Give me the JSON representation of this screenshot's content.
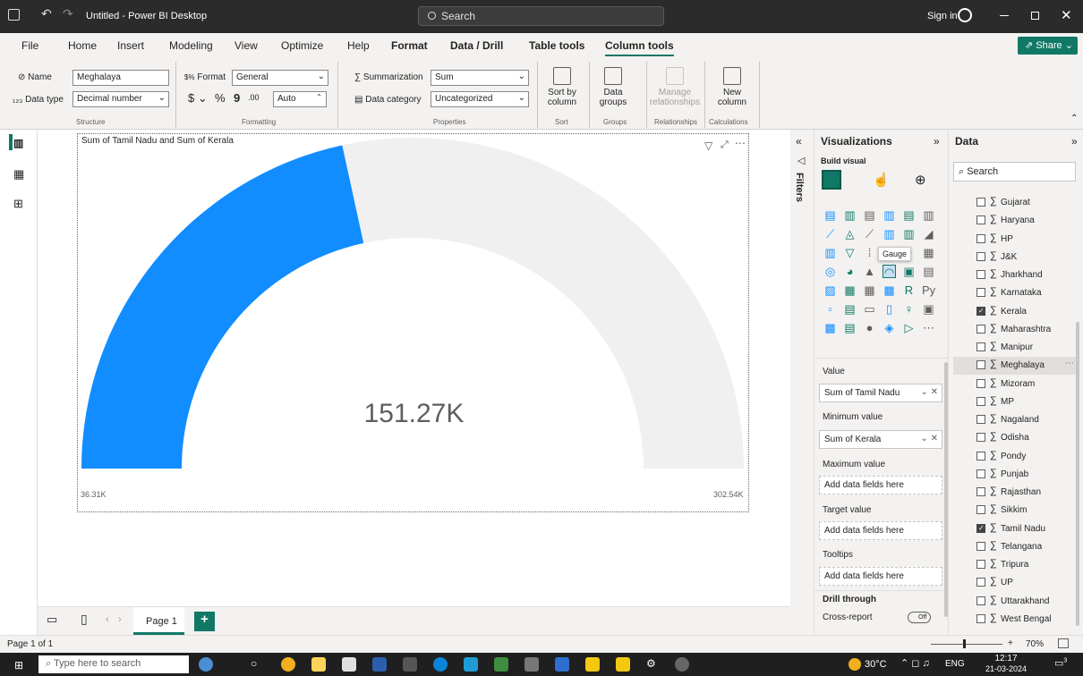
{
  "titlebar": {
    "doc_title": "Untitled - Power BI Desktop",
    "search_placeholder": "Search",
    "sign_in": "Sign in"
  },
  "tabs": [
    "File",
    "Home",
    "Insert",
    "Modeling",
    "View",
    "Optimize",
    "Help",
    "Format",
    "Data / Drill",
    "Table tools",
    "Column tools"
  ],
  "share_label": "Share",
  "ribbon": {
    "name_label": "Name",
    "name_value": "Meghalaya",
    "datatype_label": "Data type",
    "datatype_value": "Decimal number",
    "structure_group": "Structure",
    "format_label": "Format",
    "format_value": "General",
    "currency": "$",
    "percent": "%",
    "comma": "9",
    "decimals": ".00",
    "auto": "Auto",
    "formatting_group": "Formatting",
    "summarization_label": "Summarization",
    "summarization_value": "Sum",
    "datacategory_label": "Data category",
    "datacategory_value": "Uncategorized",
    "properties_group": "Properties",
    "sort_by": "Sort by",
    "column": "column",
    "sort_group": "Sort",
    "data_groups_1": "Data",
    "data_groups_2": "groups",
    "groups_group": "Groups",
    "manage_1": "Manage",
    "manage_2": "relationships",
    "relationships_group": "Relationships",
    "new_1": "New",
    "new_2": "column",
    "calculations_group": "Calculations"
  },
  "visual": {
    "title": "Sum of Tamil Nadu and Sum of Kerala",
    "value_label": "151.27K",
    "min_label": "36.31K",
    "max_label": "302.54K",
    "min": 36.31,
    "max": 302.54,
    "value": 151.27,
    "fill_color": "#118DFF",
    "track_color": "#F0F0F0"
  },
  "pagebar": {
    "page_label": "Page 1"
  },
  "statusbar": {
    "page_of": "Page 1 of 1",
    "zoom": "70%"
  },
  "filters_label": "Filters",
  "viz_pane": {
    "title": "Visualizations",
    "build_visual": "Build visual",
    "tooltip": "Gauge",
    "value_label": "Value",
    "value_field": "Sum of Tamil Nadu",
    "min_label": "Minimum value",
    "min_field": "Sum of Kerala",
    "max_label": "Maximum value",
    "max_field": "Add data fields here",
    "target_label": "Target value",
    "target_field": "Add data fields here",
    "tooltips_label": "Tooltips",
    "tooltips_field": "Add data fields here",
    "drill_label": "Drill through",
    "cross_report": "Cross-report",
    "toggle": "Off"
  },
  "data_pane": {
    "title": "Data",
    "search_placeholder": "Search",
    "fields": [
      {
        "name": "Gujarat",
        "checked": false
      },
      {
        "name": "Haryana",
        "checked": false
      },
      {
        "name": "HP",
        "checked": false
      },
      {
        "name": "J&K",
        "checked": false
      },
      {
        "name": "Jharkhand",
        "checked": false
      },
      {
        "name": "Karnataka",
        "checked": false
      },
      {
        "name": "Kerala",
        "checked": true
      },
      {
        "name": "Maharashtra",
        "checked": false
      },
      {
        "name": "Manipur",
        "checked": false
      },
      {
        "name": "Meghalaya",
        "checked": false
      },
      {
        "name": "Mizoram",
        "checked": false
      },
      {
        "name": "MP",
        "checked": false
      },
      {
        "name": "Nagaland",
        "checked": false
      },
      {
        "name": "Odisha",
        "checked": false
      },
      {
        "name": "Pondy",
        "checked": false
      },
      {
        "name": "Punjab",
        "checked": false
      },
      {
        "name": "Rajasthan",
        "checked": false
      },
      {
        "name": "Sikkim",
        "checked": false
      },
      {
        "name": "Tamil Nadu",
        "checked": true
      },
      {
        "name": "Telangana",
        "checked": false
      },
      {
        "name": "Tripura",
        "checked": false
      },
      {
        "name": "UP",
        "checked": false
      },
      {
        "name": "Uttarakhand",
        "checked": false
      },
      {
        "name": "West Bengal",
        "checked": false
      }
    ]
  },
  "taskbar": {
    "search_placeholder": "Type here to search",
    "temperature": "30°C",
    "lang": "ENG",
    "time": "12:17",
    "date": "21-03-2024",
    "notif_count": "3"
  }
}
